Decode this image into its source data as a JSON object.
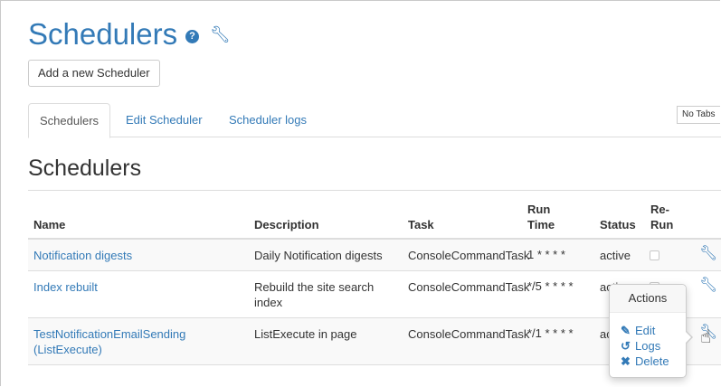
{
  "page": {
    "title": "Schedulers",
    "help_icon": "question-circle-icon",
    "title_wrench_icon": "wrench-icon"
  },
  "toolbar": {
    "add_label": "Add a new Scheduler"
  },
  "tabs": [
    {
      "label": "Schedulers",
      "active": true
    },
    {
      "label": "Edit Scheduler",
      "active": false
    },
    {
      "label": "Scheduler logs",
      "active": false
    }
  ],
  "no_tabs_label": "No Tabs",
  "section_title": "Schedulers",
  "table": {
    "headers": {
      "name": "Name",
      "description": "Description",
      "task": "Task",
      "run_time_1": "Run",
      "run_time_2": "Time",
      "status": "Status",
      "rerun_1": "Re-",
      "rerun_2": "Run"
    },
    "rows": [
      {
        "name": "Notification digests",
        "name2": "",
        "description": "Daily Notification digests",
        "description2": "",
        "task": "ConsoleCommandTask",
        "run_time": "1 * * * *",
        "status": "active",
        "rerun": false
      },
      {
        "name": "Index rebuilt",
        "name2": "",
        "description": "Rebuild the site search",
        "description2": "index",
        "task": "ConsoleCommandTask",
        "run_time": "*/5 * * * *",
        "status": "active",
        "rerun": false
      },
      {
        "name": "TestNotificationEmailSending",
        "name2": "(ListExecute)",
        "description": "ListExecute in page",
        "description2": "",
        "task": "ConsoleCommandTask",
        "run_time": "*/1 * * * *",
        "status": "ac",
        "rerun": false
      }
    ]
  },
  "actions_popover": {
    "title": "Actions",
    "items": [
      {
        "label": "Edit",
        "icon": "edit-icon"
      },
      {
        "label": "Logs",
        "icon": "history-icon"
      },
      {
        "label": "Delete",
        "icon": "delete-icon"
      }
    ]
  },
  "colors": {
    "link": "#337ab7",
    "border": "#dddddd",
    "stripe": "#f9f9f9"
  }
}
